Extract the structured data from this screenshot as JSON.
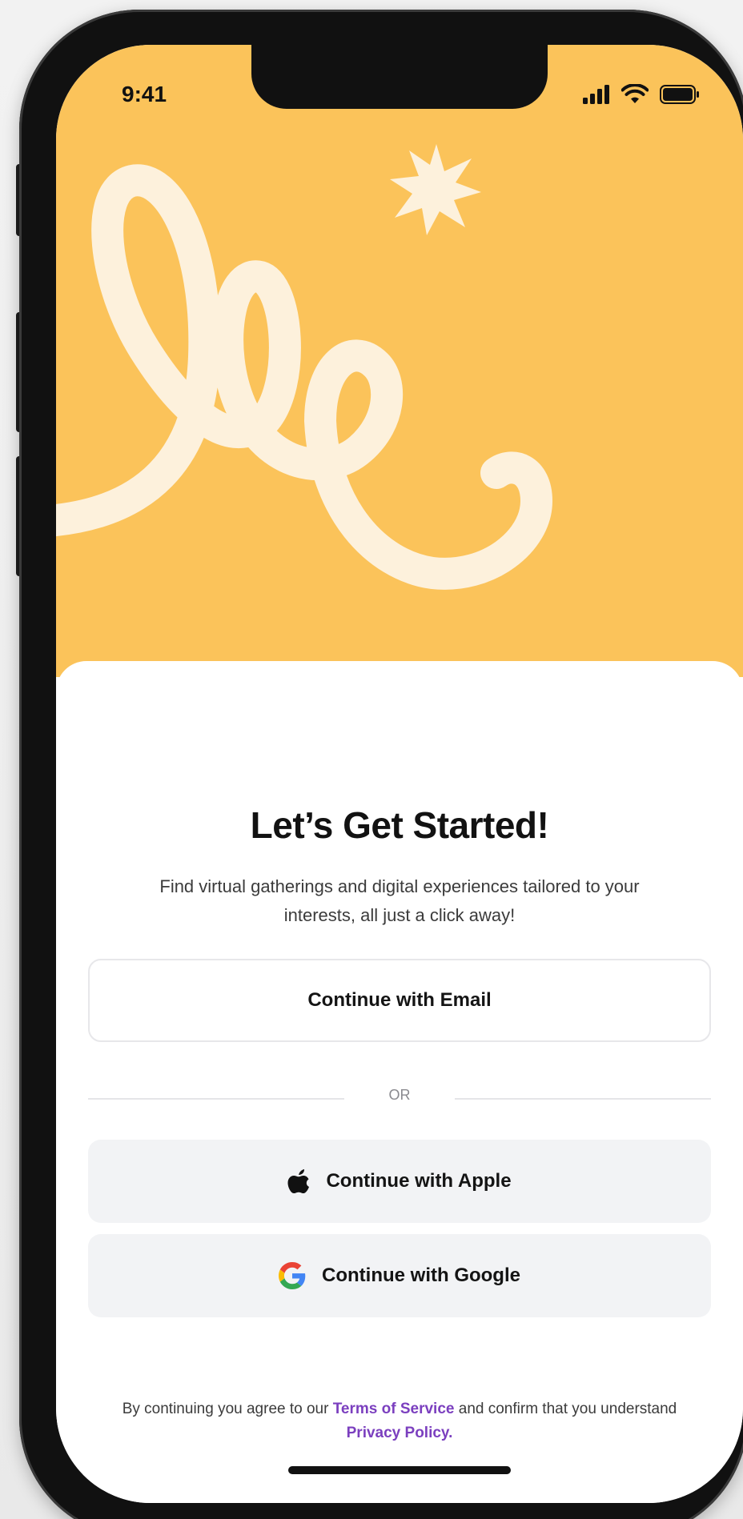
{
  "status_bar": {
    "time": "9:41",
    "signal_icon": "cellular-signal-icon",
    "wifi_icon": "wifi-icon",
    "battery_icon": "battery-icon"
  },
  "hero": {
    "background_color": "#fbc35a",
    "illustration_color": "#fdf1dc",
    "illustration_icon": "loop-scribble-illustration",
    "star_icon": "star-burst-icon"
  },
  "content": {
    "title": "Let’s Get Started!",
    "subtitle": "Find virtual gatherings and digital experiences tailored to your interests, all just a click away!"
  },
  "actions": {
    "email_label": "Continue with Email",
    "divider_label": "OR",
    "apple_label": "Continue with Apple",
    "apple_icon": "apple-logo-icon",
    "google_label": "Continue with Google",
    "google_icon": "google-logo-icon"
  },
  "legal": {
    "prefix": "By continuing you agree to our",
    "terms_link": "Terms of Service",
    "middle": "and confirm that you understand",
    "privacy_link": "Privacy Policy."
  },
  "colors": {
    "accent_link": "#7b3fbf",
    "secondary_button_bg": "#f2f3f5"
  }
}
